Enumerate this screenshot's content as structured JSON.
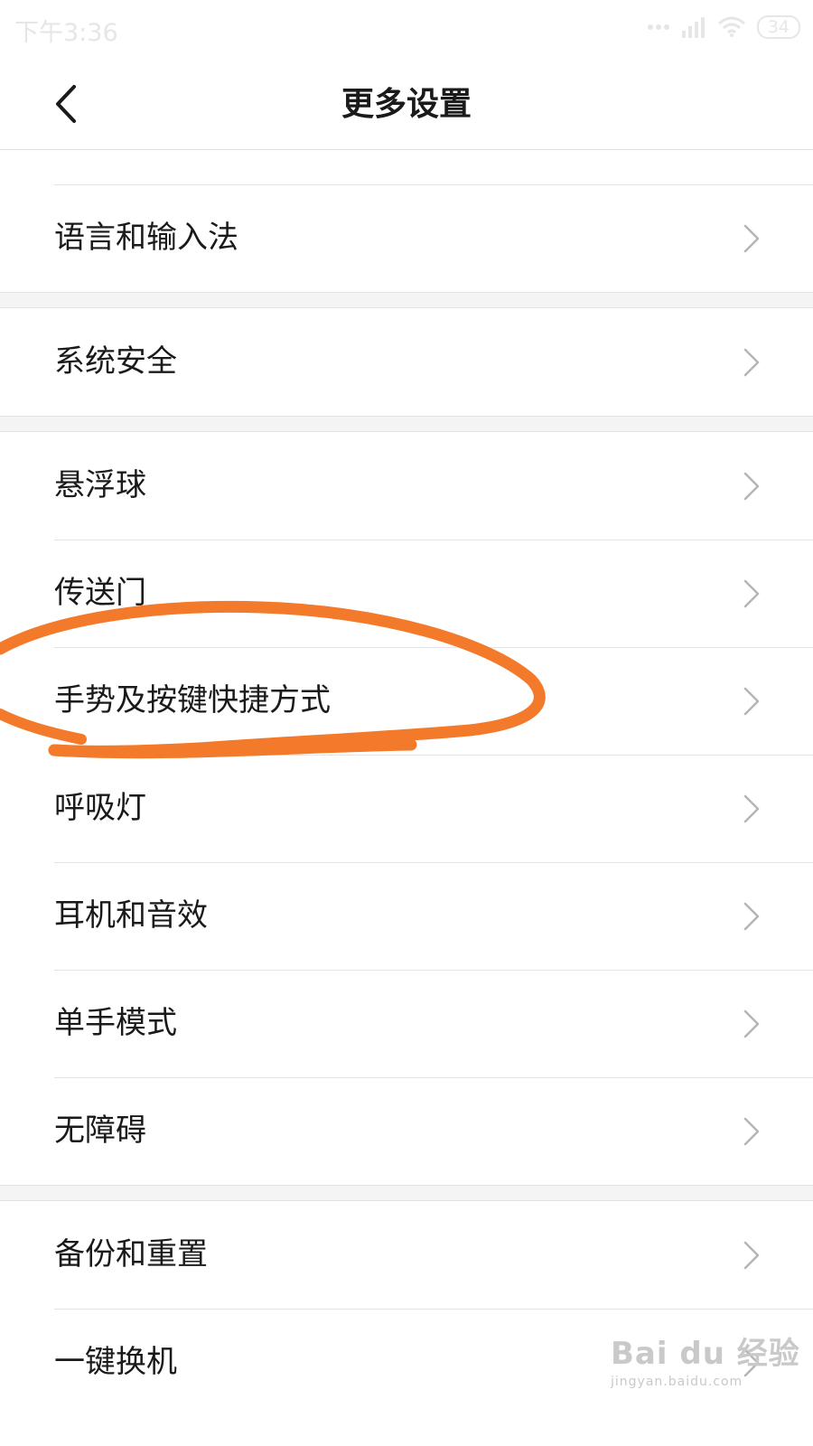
{
  "status_bar": {
    "time": "下午3:36",
    "battery": "34",
    "icons": [
      "signal-dots-icon",
      "cellular-signal-icon",
      "wifi-icon",
      "battery-icon"
    ]
  },
  "header": {
    "title": "更多设置",
    "back_icon": "chevron-left-icon"
  },
  "groups": [
    {
      "items": [
        {
          "label": "语言和输入法"
        }
      ]
    },
    {
      "items": [
        {
          "label": "系统安全"
        }
      ]
    },
    {
      "items": [
        {
          "label": "悬浮球"
        },
        {
          "label": "传送门"
        },
        {
          "label": "手势及按键快捷方式"
        },
        {
          "label": "呼吸灯"
        },
        {
          "label": "耳机和音效"
        },
        {
          "label": "单手模式"
        },
        {
          "label": "无障碍"
        }
      ]
    },
    {
      "items": [
        {
          "label": "备份和重置"
        },
        {
          "label": "一键换机"
        }
      ]
    }
  ],
  "annotation": {
    "color": "#f47a2b",
    "target": "手势及按键快捷方式"
  },
  "watermark": {
    "main": "Bai du 经验",
    "sub": "jingyan.baidu.com"
  },
  "colors": {
    "background": "#ffffff",
    "separator": "#e4e4e4",
    "group_gap": "#f4f4f4",
    "chevron": "#b5b5b5"
  }
}
